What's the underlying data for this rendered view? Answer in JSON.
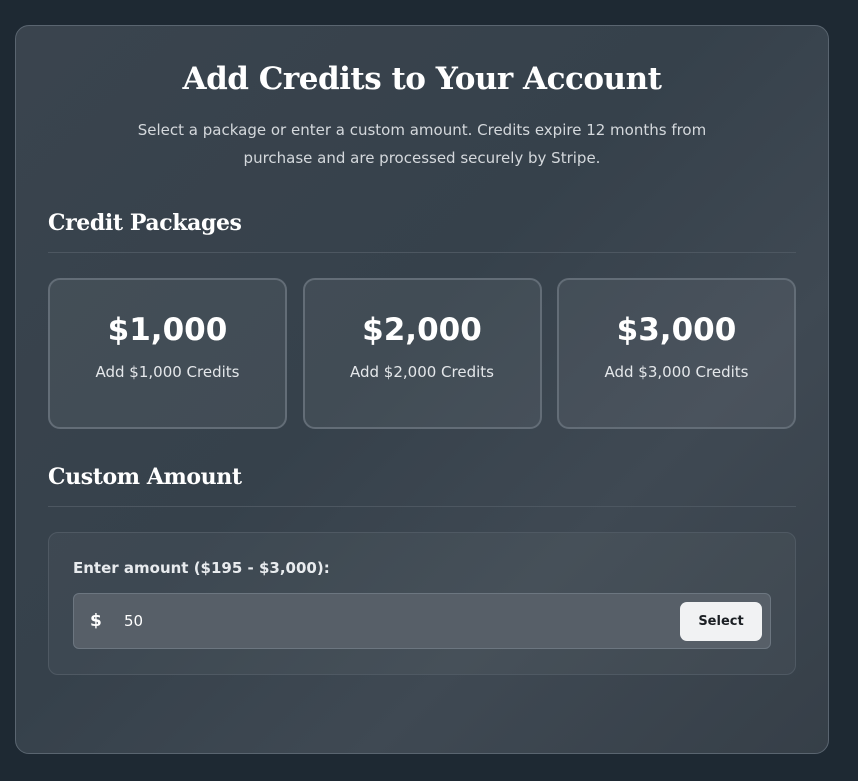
{
  "header": {
    "title": "Add Credits to Your Account",
    "subtitle": "Select a package or enter a custom amount. Credits expire 12 months from purchase and are processed securely by Stripe."
  },
  "packages_section": {
    "title": "Credit Packages",
    "items": [
      {
        "price": "$1,000",
        "label": "Add $1,000 Credits"
      },
      {
        "price": "$2,000",
        "label": "Add $2,000 Credits"
      },
      {
        "price": "$3,000",
        "label": "Add $3,000 Credits"
      }
    ]
  },
  "custom_section": {
    "title": "Custom Amount",
    "input_label": "Enter amount ($195 - $3,000):",
    "currency_symbol": "$",
    "amount_value": "50",
    "select_label": "Select"
  },
  "colors": {
    "background": "#1e2933",
    "panel": "#3a444e",
    "button": "#f1f2f3"
  }
}
